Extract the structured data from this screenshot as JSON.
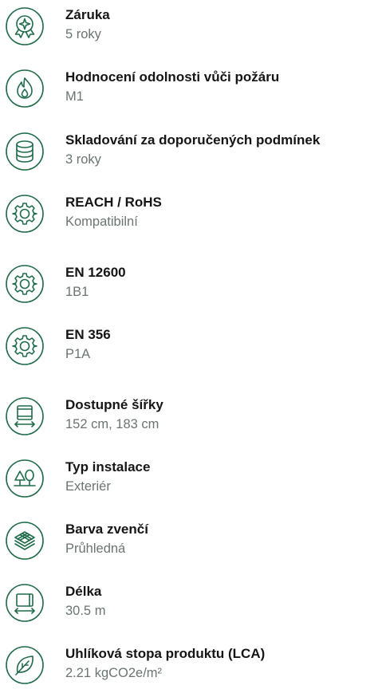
{
  "specs": [
    {
      "icon": "badge-star-icon",
      "label": "Záruka",
      "value": "5 roky"
    },
    {
      "icon": "flame-icon",
      "label": "Hodnocení odolnosti vůči požáru",
      "value": "M1"
    },
    {
      "icon": "database-icon",
      "label": "Skladování za doporučených podmínek",
      "value": "3 roky"
    },
    {
      "icon": "gear-icon",
      "label": "REACH / RoHS",
      "value": "Kompatibilní"
    },
    {
      "icon": "gear-icon",
      "label": "EN 12600",
      "value": "1B1"
    },
    {
      "icon": "gear-icon",
      "label": "EN 356",
      "value": "P1A"
    },
    {
      "icon": "roll-width-icon",
      "label": "Dostupné šířky",
      "value": "152 cm, 183 cm"
    },
    {
      "icon": "outdoor-tree-icon",
      "label": "Typ instalace",
      "value": "Exteriér"
    },
    {
      "icon": "layers-icon",
      "label": "Barva zvenčí",
      "value": "Průhledná"
    },
    {
      "icon": "roll-length-icon",
      "label": "Délka",
      "value": "30.5 m"
    },
    {
      "icon": "leaf-icon",
      "label": "Uhlíková stopa produktu (LCA)",
      "value": "2.21 kgCO2e/m²"
    }
  ],
  "colors": {
    "icon_stroke": "#1f6b4a",
    "title": "#151515",
    "value": "#6b7470"
  }
}
